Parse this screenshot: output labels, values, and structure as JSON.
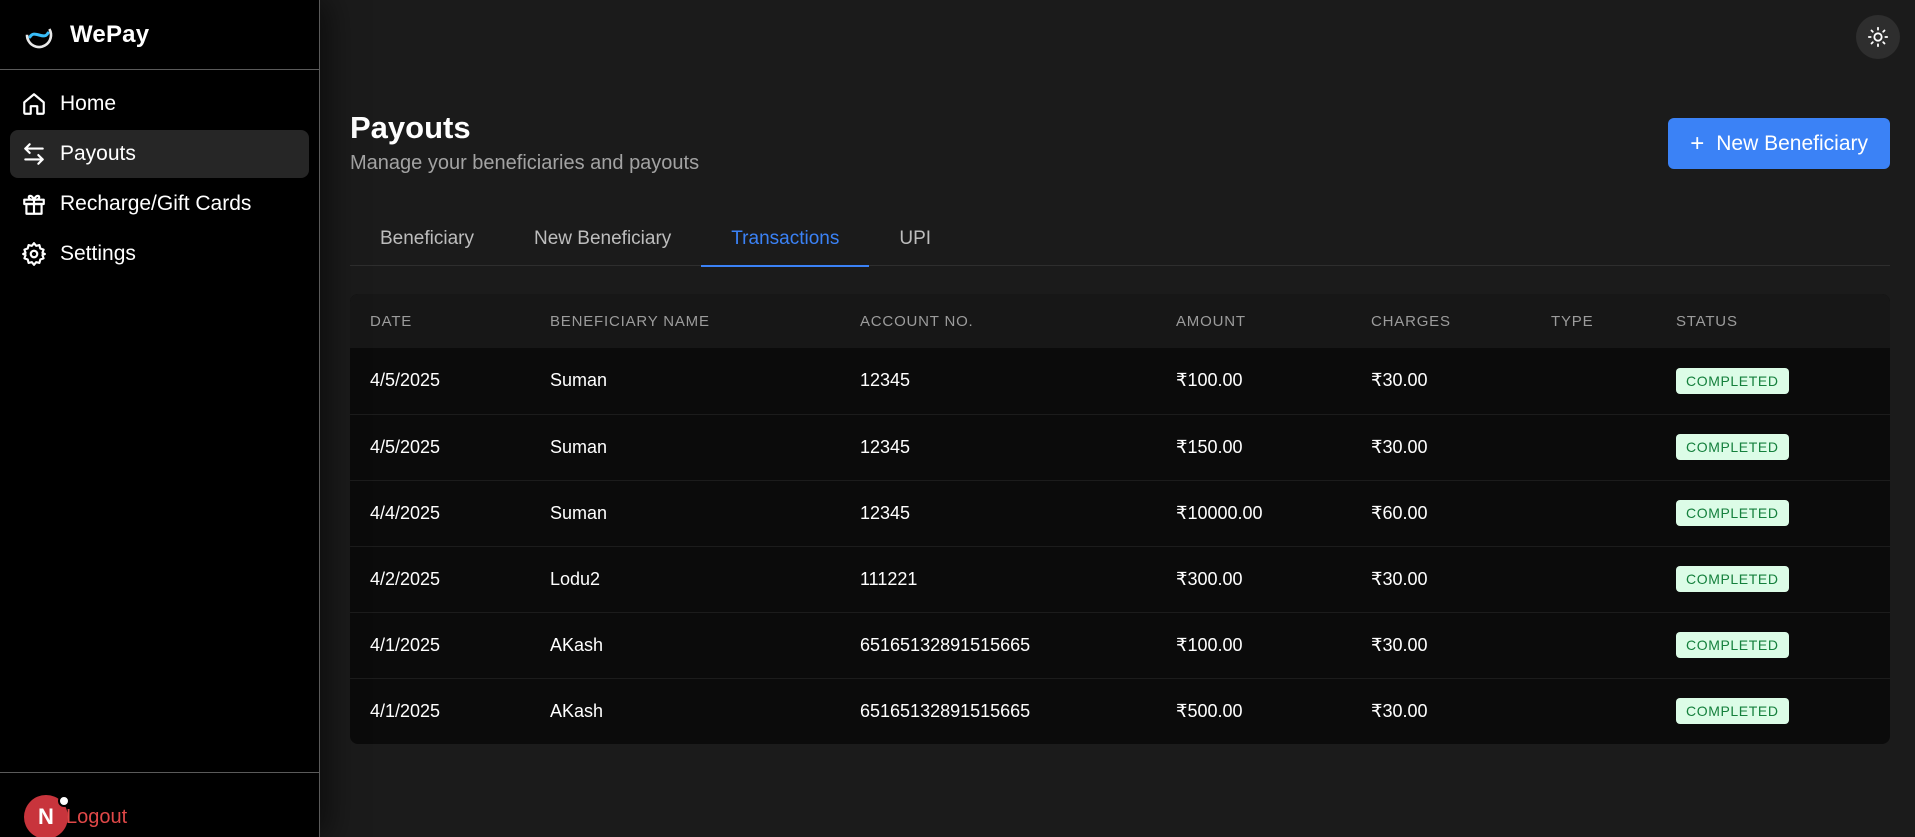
{
  "brand": {
    "name": "WePay"
  },
  "sidebar": {
    "items": [
      {
        "label": "Home",
        "icon": "home-icon",
        "active": false
      },
      {
        "label": "Payouts",
        "icon": "arrows-left-right-icon",
        "active": true
      },
      {
        "label": "Recharge/Gift Cards",
        "icon": "gift-icon",
        "active": false
      },
      {
        "label": "Settings",
        "icon": "gear-icon",
        "active": false
      }
    ],
    "avatar_initial": "N",
    "logout_label": "Logout"
  },
  "header": {
    "title": "Payouts",
    "subtitle": "Manage your beneficiaries and payouts",
    "new_beneficiary_button": "New Beneficiary",
    "theme_toggle_icon": "sun-icon"
  },
  "tabs": [
    {
      "label": "Beneficiary",
      "active": false
    },
    {
      "label": "New Beneficiary",
      "active": false
    },
    {
      "label": "Transactions",
      "active": true
    },
    {
      "label": "UPI",
      "active": false
    }
  ],
  "table": {
    "columns": [
      "DATE",
      "BENEFICIARY NAME",
      "ACCOUNT NO.",
      "AMOUNT",
      "CHARGES",
      "TYPE",
      "STATUS"
    ],
    "rows": [
      {
        "date": "4/5/2025",
        "name": "Suman",
        "account": "12345",
        "amount": "₹100.00",
        "charges": "₹30.00",
        "type": "",
        "status": "COMPLETED"
      },
      {
        "date": "4/5/2025",
        "name": "Suman",
        "account": "12345",
        "amount": "₹150.00",
        "charges": "₹30.00",
        "type": "",
        "status": "COMPLETED"
      },
      {
        "date": "4/4/2025",
        "name": "Suman",
        "account": "12345",
        "amount": "₹10000.00",
        "charges": "₹60.00",
        "type": "",
        "status": "COMPLETED"
      },
      {
        "date": "4/2/2025",
        "name": "Lodu2",
        "account": "111221",
        "amount": "₹300.00",
        "charges": "₹30.00",
        "type": "",
        "status": "COMPLETED"
      },
      {
        "date": "4/1/2025",
        "name": "AKash",
        "account": "65165132891515665",
        "amount": "₹100.00",
        "charges": "₹30.00",
        "type": "",
        "status": "COMPLETED"
      },
      {
        "date": "4/1/2025",
        "name": "AKash",
        "account": "65165132891515665",
        "amount": "₹500.00",
        "charges": "₹30.00",
        "type": "",
        "status": "COMPLETED"
      }
    ]
  },
  "colors": {
    "accent": "#3b82f6",
    "status_completed_bg": "#dcfce7",
    "status_completed_text": "#15803d",
    "logout": "#e04848"
  }
}
